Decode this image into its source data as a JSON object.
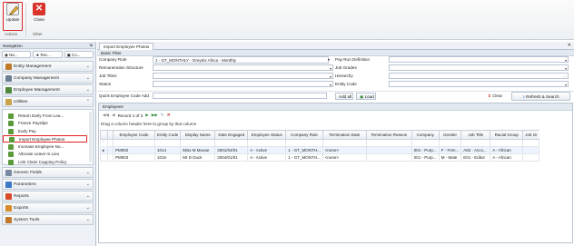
{
  "ribbon": {
    "update_label": "Update",
    "close_label": "Close",
    "group_actions": "Actions",
    "group_other": "Other"
  },
  "nav": {
    "header": "Navigation",
    "tabs": [
      "Na...",
      "Rec...",
      "Co..."
    ],
    "groups_top": [
      "Entity Management",
      "Company Management",
      "Employee Management",
      "Utilities"
    ],
    "utilities_items": [
      "Return Early From Lea...",
      "Freeze Payslips",
      "Early Pay",
      "Import Employee Photos",
      "Increase Employee No...",
      "Allocate Leave In Lieu",
      "Link Claim Capping Policy"
    ],
    "groups_bottom": [
      "Generic Fields",
      "Parameters",
      "Reports",
      "Exports",
      "System Tools"
    ]
  },
  "main": {
    "tab_title": "Import Employee Photos",
    "basic_filter": "Basic Filter",
    "filters_left": [
      {
        "label": "Company Rule",
        "value": "1 - GT_MONTHLY - Greytrix Africa - Monthly"
      },
      {
        "label": "Remuneration Structure",
        "value": ""
      },
      {
        "label": "Job Titles",
        "value": ""
      },
      {
        "label": "Status",
        "value": ""
      }
    ],
    "filters_right": [
      {
        "label": "Pay Run Definition",
        "value": ""
      },
      {
        "label": "Job Grades",
        "value": ""
      },
      {
        "label": "Hierarchy",
        "value": ""
      },
      {
        "label": "Entity Code",
        "value": ""
      }
    ],
    "quick_label": "Quick Employee Code Add",
    "add_all": "Add all",
    "load": "Load",
    "clear": "Clear",
    "refresh": "Refresh & Search",
    "employees_title": "Employees",
    "record_text": "Record 1 of 3",
    "group_hint": "Drag a column header here to group by that column",
    "columns": [
      "Employee Code",
      "Entity Code",
      "Display Name",
      "Date Engaged",
      "Employee Status",
      "Company Rule",
      "Termination Date",
      "Termination Reason",
      "Company",
      "Gender",
      "Job Title",
      "Racial Group",
      "Job Gr"
    ],
    "rows": [
      [
        "PM002",
        "1014",
        "Miss M Mouse",
        "2001/04/01",
        "A - Active",
        "1 - GT_MONTH...",
        "<none>",
        "",
        "001 - Purp...",
        "F - Fem...",
        "A02 - Acco...",
        "A - African",
        ""
      ],
      [
        "PM003",
        "1015",
        "Mr D Duck",
        "2004/01/01",
        "A - Active",
        "1 - GT_MONTH...",
        "<none>",
        "",
        "001 - Purp...",
        "M - Male",
        "E01 - Editor",
        "A - African",
        ""
      ]
    ]
  },
  "colors": {
    "highlight": "#e02020",
    "accent": "#3a78c8"
  }
}
